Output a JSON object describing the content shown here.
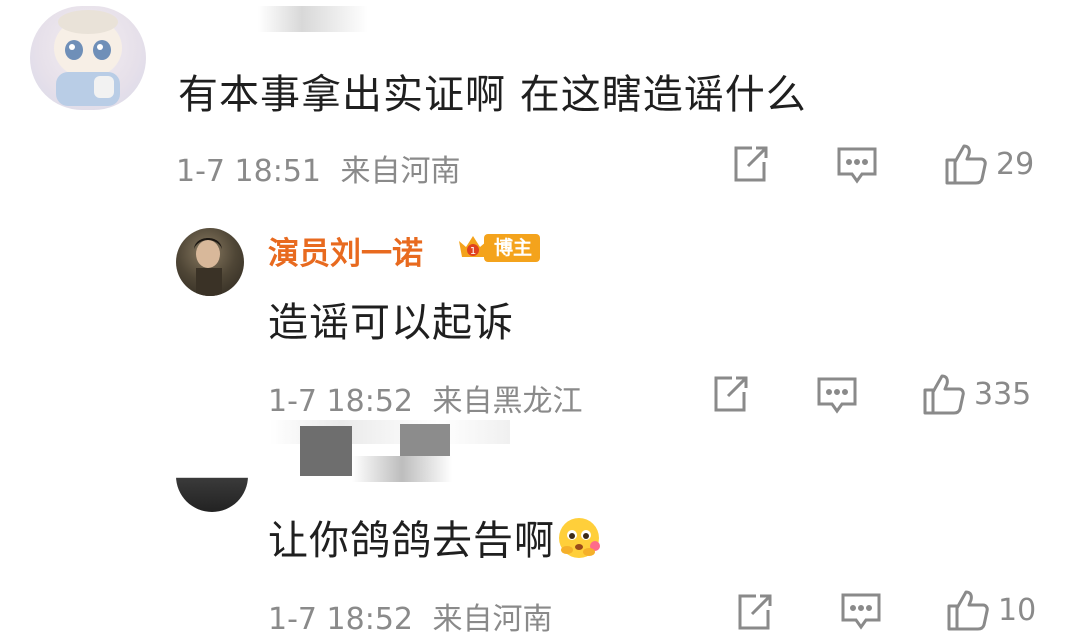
{
  "comments": [
    {
      "content": "有本事拿出实证啊 在这瞎造谣什么",
      "time": "1-7 18:51",
      "location": "来自河南",
      "likes": "29",
      "icons": [
        "share-icon",
        "comment-icon",
        "like-icon"
      ]
    },
    {
      "username": "演员刘一诺",
      "badge": "博主",
      "content": "造谣可以起诉",
      "time": "1-7 18:52",
      "location": "来自黑龙江",
      "likes": "335",
      "icons": [
        "share-icon",
        "comment-icon",
        "like-icon"
      ]
    },
    {
      "content": "让你鸽鸽去告啊",
      "time": "1-7 18:52",
      "location": "来自河南",
      "likes": "10",
      "icons": [
        "share-icon",
        "comment-icon",
        "like-icon"
      ]
    }
  ],
  "colors": {
    "username": "#e86a1f",
    "badge": "#f4a31c",
    "meta": "#8a8a8a",
    "text": "#1f1f1f"
  }
}
